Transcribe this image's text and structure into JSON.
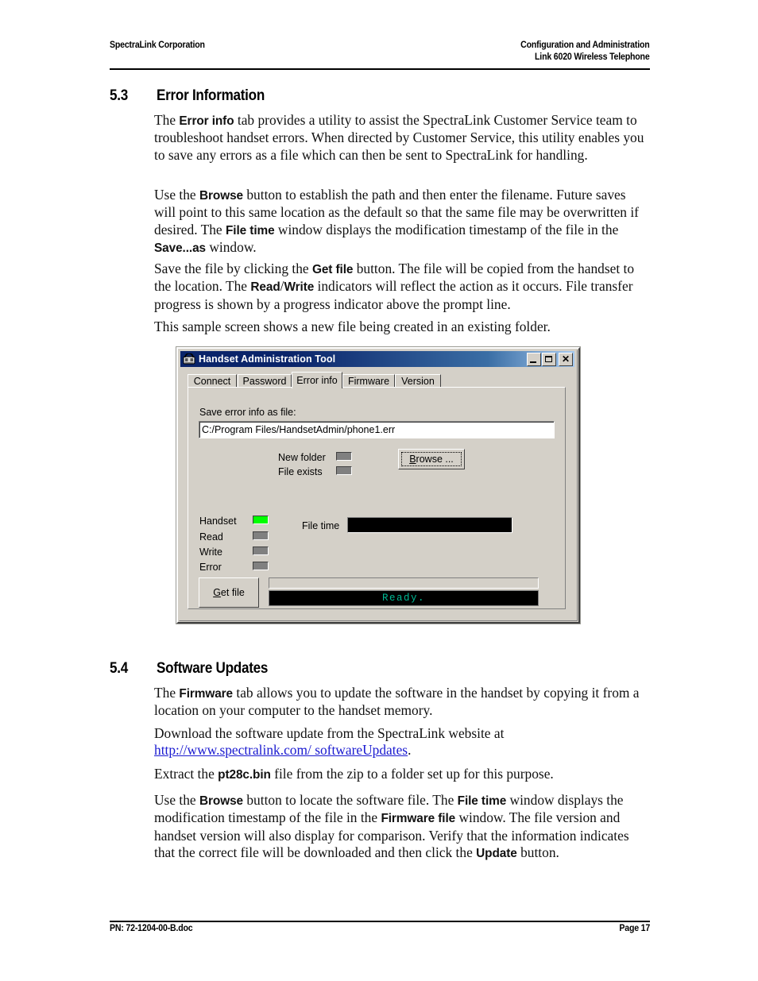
{
  "header": {
    "left": "SpectraLink Corporation",
    "right_line1": "Configuration and Administration",
    "right_line2": "Link 6020 Wireless Telephone"
  },
  "footer": {
    "left": "PN: 72-1204-00-B.doc",
    "right": "Page 17"
  },
  "section_53": {
    "number": "5.3",
    "title": "Error Information",
    "paragraphs": {
      "p1_a": "The ",
      "p1_b": "Error info",
      "p1_c": " tab provides a utility to assist the SpectraLink Customer Service team to troubleshoot handset errors. When directed by Customer Service, this utility enables you to save any errors as a file which can then be sent to SpectraLink for handling.",
      "p2_a": "Use the ",
      "p2_b": "Browse",
      "p2_c": " button to establish the path and then enter the filename. Future saves will point to this same location as the default so that the same file may be overwritten if desired. The ",
      "p2_d": "File time",
      "p2_e": " window displays the modification timestamp of the file in the ",
      "p2_f": "Save...as",
      "p2_g": " window.",
      "p3_a": "Save the file by clicking the ",
      "p3_b": "Get file",
      "p3_c": " button. The file will be copied from the handset to the location. The ",
      "p3_d": "Read",
      "p3_e": "/",
      "p3_f": "Write",
      "p3_g": " indicators will reflect the action as it occurs. File transfer progress is shown by a progress indicator above the prompt line.",
      "p4": "This sample screen shows a new file being created in an existing folder."
    }
  },
  "section_54": {
    "number": "5.4",
    "title": "Software Updates",
    "paragraphs": {
      "p1_a": "The ",
      "p1_b": "Firmware",
      "p1_c": " tab allows you to update the software in the handset by copying it from a location on your computer to the handset memory.",
      "p2_a": "Download the software update from the SpectraLink website at ",
      "p2_link": "http://www.spectralink.com/ softwareUpdates",
      "p2_b": ".",
      "p3_a": "Extract the ",
      "p3_b": "pt28c.bin",
      "p3_c": " file from the zip to a folder set up for this purpose.",
      "p4_a": "Use the ",
      "p4_b": "Browse",
      "p4_c": " button to locate the software file. The ",
      "p4_d": "File time",
      "p4_e": " window displays the modification timestamp of the file in the ",
      "p4_f": "Firmware file",
      "p4_g": " window. The file version and handset version will also display for comparison. Verify that the information indicates that the correct file will be downloaded and then click the ",
      "p4_h": "Update",
      "p4_i": " button."
    }
  },
  "dialog": {
    "title": "Handset Administration Tool",
    "window_buttons": {
      "minimize": "_",
      "maximize": "□",
      "close": "✕"
    },
    "tabs": [
      {
        "label": "Connect",
        "active": false
      },
      {
        "label": "Password",
        "active": false
      },
      {
        "label": "Error info",
        "active": true
      },
      {
        "label": "Firmware",
        "active": false
      },
      {
        "label": "Version",
        "active": false
      }
    ],
    "save_as_label": "Save error info as file:",
    "file_path_value": "C:/Program Files/HandsetAdmin/phone1.err",
    "flags": [
      {
        "label": "New folder",
        "state": "off"
      },
      {
        "label": "File exists",
        "state": "off"
      }
    ],
    "browse_button": {
      "accel": "B",
      "rest": "rowse ..."
    },
    "indicators": [
      {
        "label": "Handset",
        "state": "on"
      },
      {
        "label": "Read",
        "state": "off"
      },
      {
        "label": "Write",
        "state": "off"
      },
      {
        "label": "Error",
        "state": "off"
      }
    ],
    "file_time_label": "File time",
    "file_time_value": "",
    "get_file_button": {
      "accel": "G",
      "rest": "et file"
    },
    "progress_value": "",
    "status_text": "Ready.",
    "colors": {
      "led_on": "#00ff00",
      "led_off": "#808080",
      "status_text": "#00b894",
      "titlebar_start": "#0a246a",
      "titlebar_end": "#a6caf0",
      "face": "#d4d0c8"
    }
  }
}
